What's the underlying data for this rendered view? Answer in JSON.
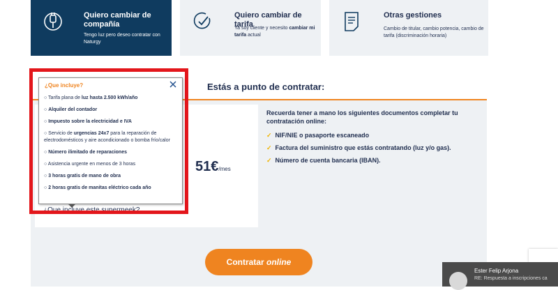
{
  "cards": [
    {
      "title": "Quiero cambiar de compañía",
      "desc_prefix": "Tengo luz pero deseo contratar con Naturgy",
      "icon": "power-plug-icon"
    },
    {
      "title": "Quiero cambiar de tarifa",
      "desc_prefix": "Ya soy cliente y necesito ",
      "desc_bold": "cambiar mi tarifa",
      "desc_suffix": " actual",
      "icon": "check-circle-icon"
    },
    {
      "title": "Otras gestiones",
      "desc": "Cambio de titular, cambio potencia, cambio de tarifa (discriminación horaria)",
      "icon": "document-icon"
    }
  ],
  "main": {
    "heading": "Estás a punto de contratar:",
    "price_value": "51€",
    "price_unit": "/mes",
    "peek_link": "¿Que incluye este supermeek?",
    "info_heading": "Recuerda tener a mano los siguientes documentos completar tu contratación online:",
    "documents": [
      "NIF/NIE o pasaporte escaneado",
      "Factura del suministro que estás contratando (luz y/o gas).",
      "Número de cuenta bancaria (IBAN)."
    ],
    "check_symbol": "✓",
    "cta_prefix": "Contratar ",
    "cta_italic": "online"
  },
  "popover": {
    "title": "¿Que incluye?",
    "items": [
      {
        "pre": "○ Tarifa plana de ",
        "bold": "luz hasta 2.500 kWh/año",
        "post": ""
      },
      {
        "pre": "○ ",
        "bold": "Alquiler del contador",
        "post": ""
      },
      {
        "pre": "○  ",
        "bold": "Impuesto sobre la electricidad e IVA",
        "post": ""
      },
      {
        "pre": "○ Servicio de ",
        "bold": "urgencias 24x7",
        "post": " para la reparación de electrodomésticos y aire acondicionado o bomba frío/calor"
      },
      {
        "pre": "○ ",
        "bold": "Número ilimitado de reparaciones",
        "post": ""
      },
      {
        "pre": "○ Asistencia urgente en menos de 3 horas",
        "bold": "",
        "post": ""
      },
      {
        "pre": "○ ",
        "bold": "3 horas gratis de mano de obra",
        "post": ""
      },
      {
        "pre": "○ ",
        "bold": "2 horas gratis de manitas eléctrico cada año",
        "post": ""
      }
    ]
  },
  "chat": {
    "name": "Ester Felip Arjona",
    "subject": "RE: Respuesta a inscripciones ca"
  },
  "colors": {
    "navy": "#0f3b5f",
    "orange": "#ef8420",
    "highlight_red": "#e3161b",
    "check_yellow": "#f0b400"
  }
}
